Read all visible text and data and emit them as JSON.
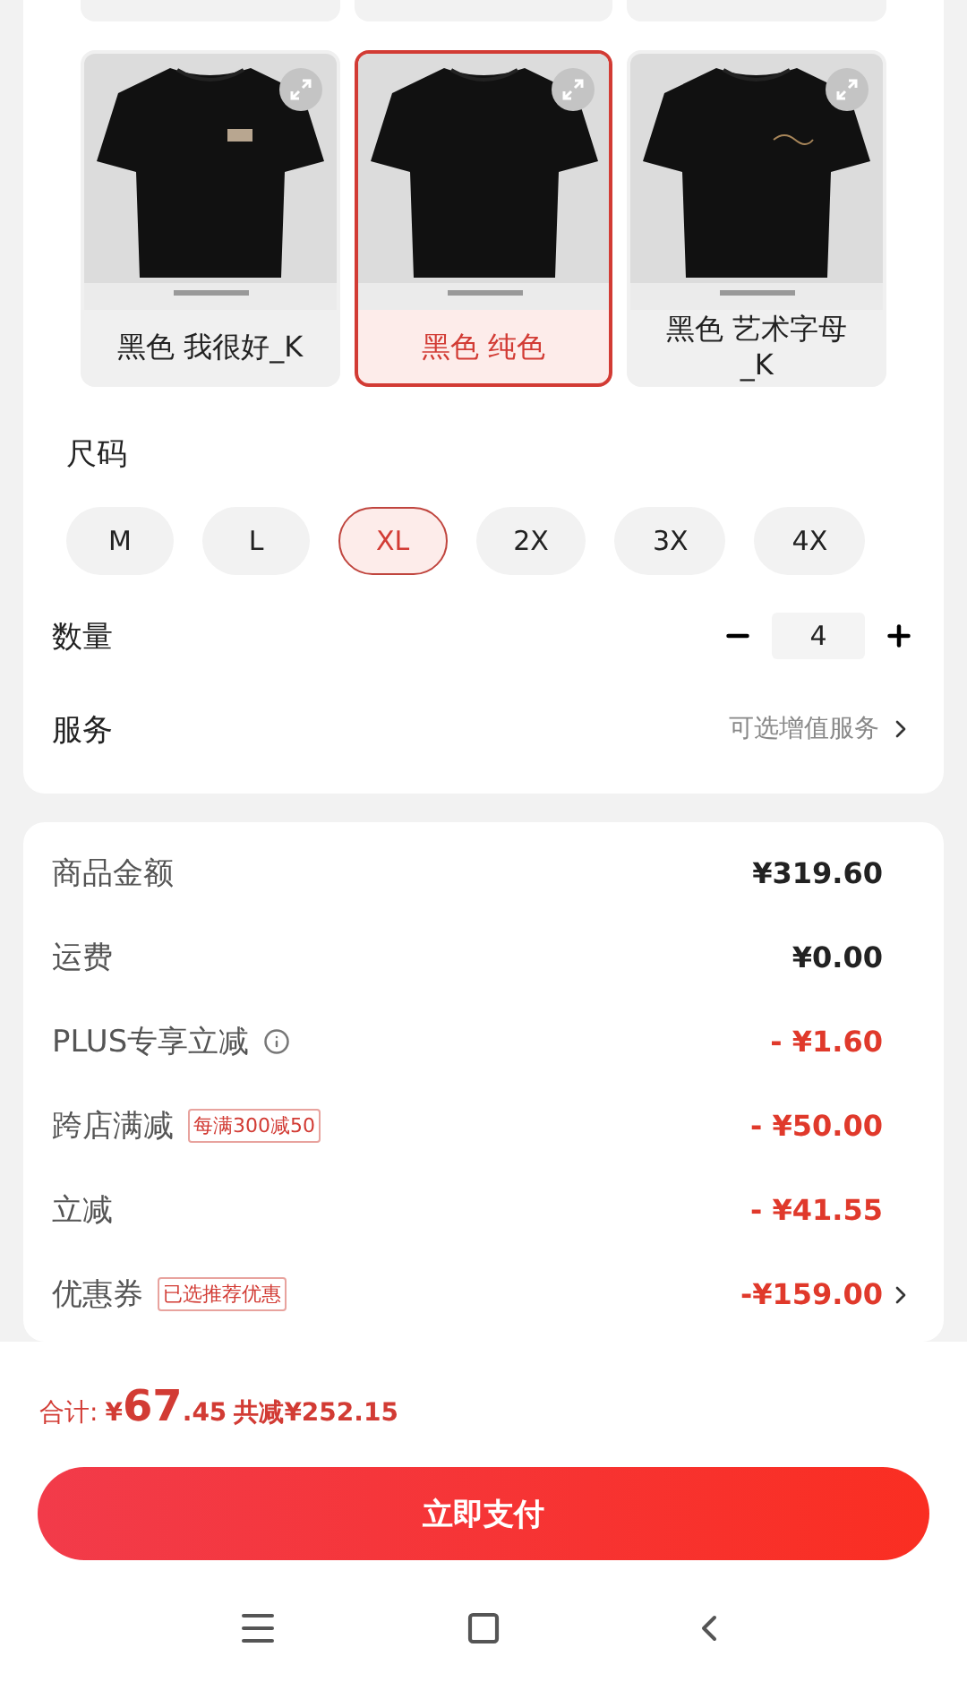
{
  "colors": [
    {
      "label": "黑色 我很好_K",
      "selected": false
    },
    {
      "label": "黑色 纯色",
      "selected": true
    },
    {
      "label": "黑色 艺术字母_K",
      "selected": false
    }
  ],
  "size": {
    "title": "尺码",
    "options": [
      {
        "label": "M",
        "selected": false
      },
      {
        "label": "L",
        "selected": false
      },
      {
        "label": "XL",
        "selected": true
      },
      {
        "label": "2X",
        "selected": false
      },
      {
        "label": "3X",
        "selected": false
      },
      {
        "label": "4X",
        "selected": false
      }
    ]
  },
  "quantity": {
    "label": "数量",
    "value": "4"
  },
  "service": {
    "label": "服务",
    "hint": "可选增值服务"
  },
  "summary": [
    {
      "label": "商品金额",
      "amount": "¥319.60",
      "kind": "plain"
    },
    {
      "label": "运费",
      "amount": "¥0.00",
      "kind": "plain"
    },
    {
      "label": "PLUS专享立减",
      "amount": "- ¥1.60",
      "kind": "discount",
      "info": true
    },
    {
      "label": "跨店满减",
      "tag": "每满300减50",
      "amount": "- ¥50.00",
      "kind": "discount"
    },
    {
      "label": "立减",
      "amount": "- ¥41.55",
      "kind": "discount"
    },
    {
      "label": "优惠券",
      "tag": "已选推荐优惠",
      "amount": "-¥159.00",
      "kind": "discount",
      "arrow": true
    }
  ],
  "footer": {
    "total_label": "合计:",
    "currency": "¥",
    "integer": "67",
    "decimal": ".45",
    "saved": "共减¥252.15",
    "pay_button": "立即支付"
  }
}
